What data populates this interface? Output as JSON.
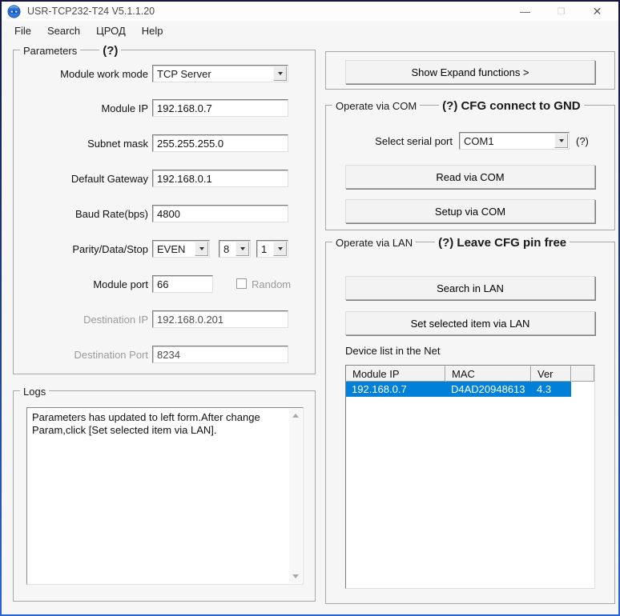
{
  "colors": {
    "selection_blue": "#0080d8",
    "frame_gradient_top": "#15153f",
    "frame_gradient_bottom": "#2a64d4",
    "window_background": "#f5f6f5"
  },
  "titlebar": {
    "title": "USR-TCP232-T24 V5.1.1.20",
    "minimize_glyph": "—",
    "maximize_glyph": "❐",
    "close_glyph": "✕"
  },
  "menu": {
    "items": [
      {
        "label": "File"
      },
      {
        "label": "Search"
      },
      {
        "label": "ЦРОД"
      },
      {
        "label": "Help"
      }
    ]
  },
  "parameters": {
    "title": "Parameters",
    "hint": "(?)",
    "module_work_mode": {
      "label": "Module work mode",
      "value": "TCP Server"
    },
    "module_ip": {
      "label": "Module IP",
      "value": "192.168.0.7"
    },
    "subnet_mask": {
      "label": "Subnet mask",
      "value": "255.255.255.0"
    },
    "default_gateway": {
      "label": "Default Gateway",
      "value": "192.168.0.1"
    },
    "baud_rate": {
      "label": "Baud Rate(bps)",
      "value": "4800"
    },
    "parity_data_stop": {
      "label": "Parity/Data/Stop",
      "parity": "EVEN",
      "data_bits": "8",
      "stop_bits": "1"
    },
    "module_port": {
      "label": "Module port",
      "value": "66",
      "random_label": "Random",
      "random_checked": false
    },
    "destination_ip": {
      "label": "Destination IP",
      "value": "192.168.0.201",
      "disabled": true
    },
    "destination_port": {
      "label": "Destination Port",
      "value": "8234",
      "disabled": true
    }
  },
  "logs": {
    "title": "Logs",
    "text": "Parameters has updated to left form.After change Param,click [Set selected item via LAN]."
  },
  "expand": {
    "button_label": "Show Expand functions >"
  },
  "com": {
    "title": "Operate via COM",
    "hint": "(?) CFG connect to GND",
    "serial_port": {
      "label": "Select serial port",
      "value": "COM1",
      "hint": "(?)"
    },
    "read_button": "Read via COM",
    "setup_button": "Setup via COM"
  },
  "lan": {
    "title": "Operate via LAN",
    "hint": "(?) Leave CFG pin free",
    "search_button": "Search in LAN",
    "set_button": "Set selected item via LAN",
    "device_list_label": "Device list in the Net",
    "device_list": {
      "columns": [
        "Module IP",
        "MAC",
        "Ver"
      ],
      "rows": [
        {
          "module_ip": "192.168.0.7",
          "mac": "D4AD20948613",
          "ver": "4.3",
          "selected": true
        }
      ]
    }
  }
}
